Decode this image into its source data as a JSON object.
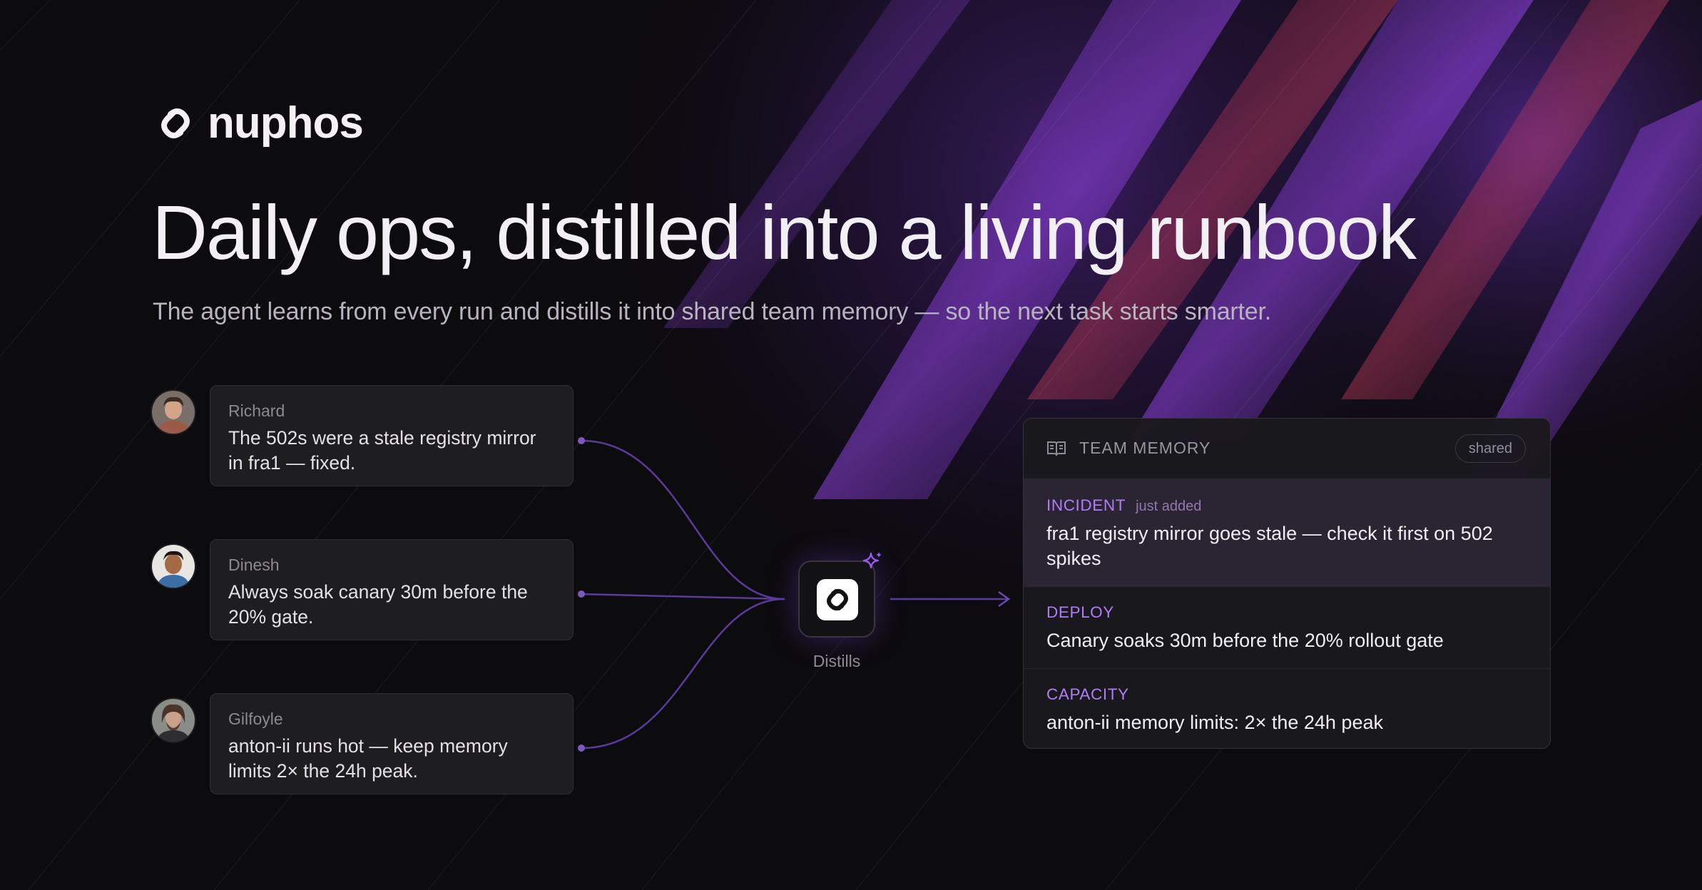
{
  "brand": {
    "name": "nuphos",
    "logo_icon": "link-icon"
  },
  "hero": {
    "title": "Daily ops, distilled into a living runbook",
    "subtitle": "The agent learns from every run and distills it into shared team memory — so the next task starts smarter."
  },
  "messages": [
    {
      "name": "Richard",
      "text": "The 502s were a stale registry mirror in fra1 — fixed."
    },
    {
      "name": "Dinesh",
      "text": "Always soak canary 30m before the 20% gate."
    },
    {
      "name": "Gilfoyle",
      "text": "anton-ii runs hot — keep memory limits 2× the 24h peak."
    }
  ],
  "hub": {
    "label": "Distills",
    "icon": "link-icon",
    "badge_icon": "sparkle-icon"
  },
  "memory": {
    "title": "TEAM MEMORY",
    "icon": "book-icon",
    "badge": "shared",
    "entries": [
      {
        "category": "INCIDENT",
        "tag": "just added",
        "text": "fra1 registry mirror goes stale — check it first on 502 spikes"
      },
      {
        "category": "DEPLOY",
        "tag": "",
        "text": "Canary soaks 30m before the 20% rollout gate"
      },
      {
        "category": "CAPACITY",
        "tag": "",
        "text": "anton-ii memory limits: 2× the 24h peak"
      }
    ]
  },
  "colors": {
    "accent": "#b07df7",
    "background": "#0c0b0e",
    "card": "#1f1e21",
    "highlight_row": "#2a2433"
  }
}
